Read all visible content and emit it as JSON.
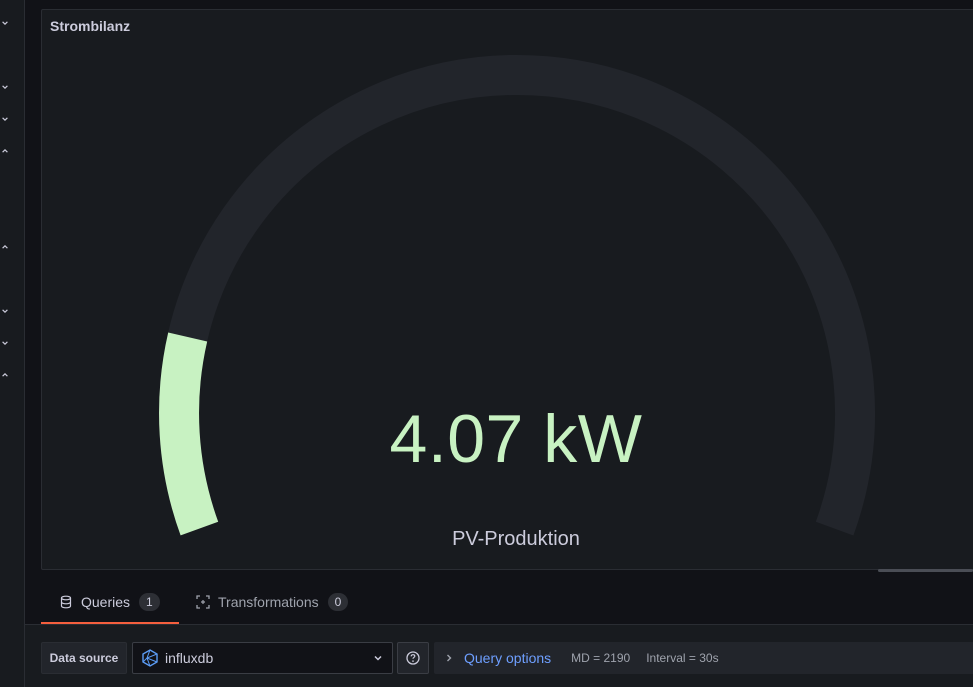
{
  "panel": {
    "title": "Strombilanz",
    "gauge": {
      "value_text": "4.07 kW",
      "name": "PV-Produktion",
      "fill_fraction": 0.15,
      "fill_color": "#c8f2c2",
      "track_color": "#22252b"
    }
  },
  "sidebar": {
    "chevrons": [
      "down",
      "down",
      "down",
      "up",
      "up",
      "down",
      "down",
      "up"
    ]
  },
  "tabs": [
    {
      "label": "Queries",
      "count": "1",
      "icon": "database-icon",
      "active": true
    },
    {
      "label": "Transformations",
      "count": "0",
      "icon": "transform-icon",
      "active": false
    }
  ],
  "query": {
    "datasource_label": "Data source",
    "datasource_value": "influxdb",
    "query_options_title": "Query options",
    "md": "MD = 2190",
    "interval": "Interval = 30s"
  },
  "colors": {
    "accent_tab": "#f55f3e",
    "link_blue": "#6e9fff",
    "background": "#111217",
    "panel": "#181b1f"
  }
}
